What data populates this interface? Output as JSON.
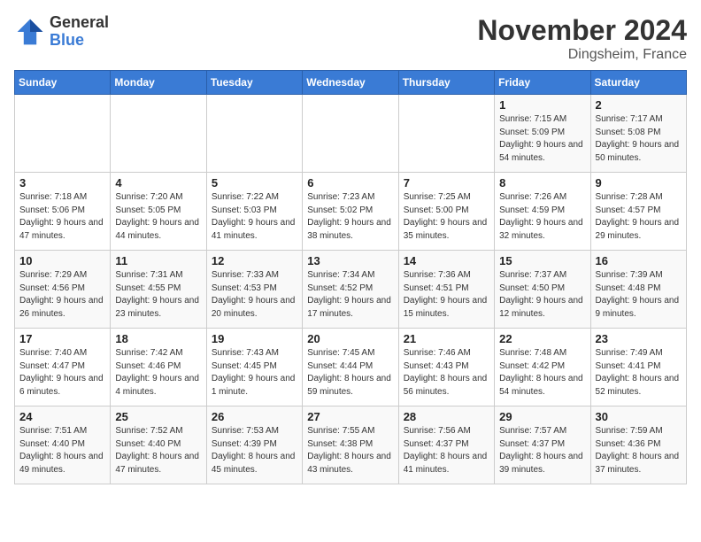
{
  "logo": {
    "general": "General",
    "blue": "Blue"
  },
  "header": {
    "month": "November 2024",
    "location": "Dingsheim, France"
  },
  "weekdays": [
    "Sunday",
    "Monday",
    "Tuesday",
    "Wednesday",
    "Thursday",
    "Friday",
    "Saturday"
  ],
  "weeks": [
    [
      {
        "day": "",
        "info": ""
      },
      {
        "day": "",
        "info": ""
      },
      {
        "day": "",
        "info": ""
      },
      {
        "day": "",
        "info": ""
      },
      {
        "day": "",
        "info": ""
      },
      {
        "day": "1",
        "info": "Sunrise: 7:15 AM\nSunset: 5:09 PM\nDaylight: 9 hours and 54 minutes."
      },
      {
        "day": "2",
        "info": "Sunrise: 7:17 AM\nSunset: 5:08 PM\nDaylight: 9 hours and 50 minutes."
      }
    ],
    [
      {
        "day": "3",
        "info": "Sunrise: 7:18 AM\nSunset: 5:06 PM\nDaylight: 9 hours and 47 minutes."
      },
      {
        "day": "4",
        "info": "Sunrise: 7:20 AM\nSunset: 5:05 PM\nDaylight: 9 hours and 44 minutes."
      },
      {
        "day": "5",
        "info": "Sunrise: 7:22 AM\nSunset: 5:03 PM\nDaylight: 9 hours and 41 minutes."
      },
      {
        "day": "6",
        "info": "Sunrise: 7:23 AM\nSunset: 5:02 PM\nDaylight: 9 hours and 38 minutes."
      },
      {
        "day": "7",
        "info": "Sunrise: 7:25 AM\nSunset: 5:00 PM\nDaylight: 9 hours and 35 minutes."
      },
      {
        "day": "8",
        "info": "Sunrise: 7:26 AM\nSunset: 4:59 PM\nDaylight: 9 hours and 32 minutes."
      },
      {
        "day": "9",
        "info": "Sunrise: 7:28 AM\nSunset: 4:57 PM\nDaylight: 9 hours and 29 minutes."
      }
    ],
    [
      {
        "day": "10",
        "info": "Sunrise: 7:29 AM\nSunset: 4:56 PM\nDaylight: 9 hours and 26 minutes."
      },
      {
        "day": "11",
        "info": "Sunrise: 7:31 AM\nSunset: 4:55 PM\nDaylight: 9 hours and 23 minutes."
      },
      {
        "day": "12",
        "info": "Sunrise: 7:33 AM\nSunset: 4:53 PM\nDaylight: 9 hours and 20 minutes."
      },
      {
        "day": "13",
        "info": "Sunrise: 7:34 AM\nSunset: 4:52 PM\nDaylight: 9 hours and 17 minutes."
      },
      {
        "day": "14",
        "info": "Sunrise: 7:36 AM\nSunset: 4:51 PM\nDaylight: 9 hours and 15 minutes."
      },
      {
        "day": "15",
        "info": "Sunrise: 7:37 AM\nSunset: 4:50 PM\nDaylight: 9 hours and 12 minutes."
      },
      {
        "day": "16",
        "info": "Sunrise: 7:39 AM\nSunset: 4:48 PM\nDaylight: 9 hours and 9 minutes."
      }
    ],
    [
      {
        "day": "17",
        "info": "Sunrise: 7:40 AM\nSunset: 4:47 PM\nDaylight: 9 hours and 6 minutes."
      },
      {
        "day": "18",
        "info": "Sunrise: 7:42 AM\nSunset: 4:46 PM\nDaylight: 9 hours and 4 minutes."
      },
      {
        "day": "19",
        "info": "Sunrise: 7:43 AM\nSunset: 4:45 PM\nDaylight: 9 hours and 1 minute."
      },
      {
        "day": "20",
        "info": "Sunrise: 7:45 AM\nSunset: 4:44 PM\nDaylight: 8 hours and 59 minutes."
      },
      {
        "day": "21",
        "info": "Sunrise: 7:46 AM\nSunset: 4:43 PM\nDaylight: 8 hours and 56 minutes."
      },
      {
        "day": "22",
        "info": "Sunrise: 7:48 AM\nSunset: 4:42 PM\nDaylight: 8 hours and 54 minutes."
      },
      {
        "day": "23",
        "info": "Sunrise: 7:49 AM\nSunset: 4:41 PM\nDaylight: 8 hours and 52 minutes."
      }
    ],
    [
      {
        "day": "24",
        "info": "Sunrise: 7:51 AM\nSunset: 4:40 PM\nDaylight: 8 hours and 49 minutes."
      },
      {
        "day": "25",
        "info": "Sunrise: 7:52 AM\nSunset: 4:40 PM\nDaylight: 8 hours and 47 minutes."
      },
      {
        "day": "26",
        "info": "Sunrise: 7:53 AM\nSunset: 4:39 PM\nDaylight: 8 hours and 45 minutes."
      },
      {
        "day": "27",
        "info": "Sunrise: 7:55 AM\nSunset: 4:38 PM\nDaylight: 8 hours and 43 minutes."
      },
      {
        "day": "28",
        "info": "Sunrise: 7:56 AM\nSunset: 4:37 PM\nDaylight: 8 hours and 41 minutes."
      },
      {
        "day": "29",
        "info": "Sunrise: 7:57 AM\nSunset: 4:37 PM\nDaylight: 8 hours and 39 minutes."
      },
      {
        "day": "30",
        "info": "Sunrise: 7:59 AM\nSunset: 4:36 PM\nDaylight: 8 hours and 37 minutes."
      }
    ]
  ]
}
